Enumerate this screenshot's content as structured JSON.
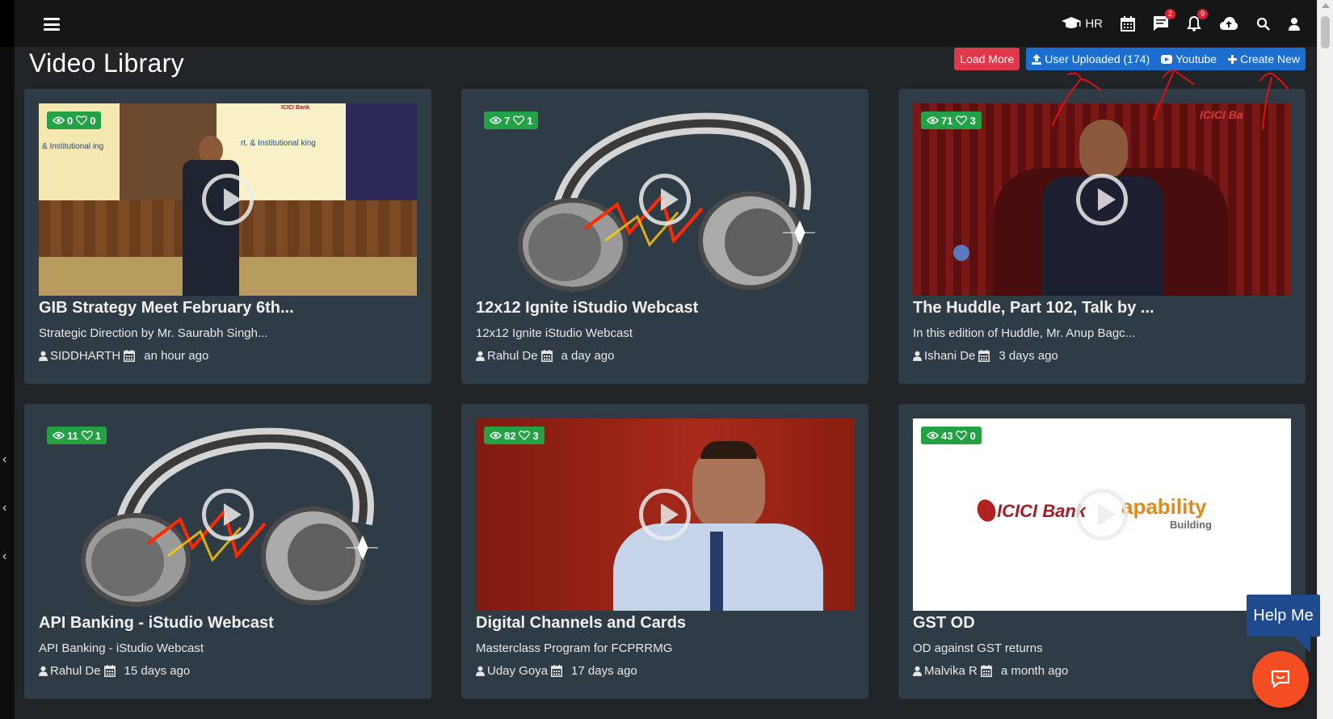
{
  "header": {
    "hr_label": "HR",
    "messages_badge": "2",
    "notifications_badge": "9"
  },
  "page": {
    "title": "Video Library"
  },
  "actions": {
    "load_more": "Load More",
    "user_uploaded": "User Uploaded (174)",
    "youtube": "Youtube",
    "create_new": "Create New"
  },
  "videos": [
    {
      "views": "0",
      "likes": "0",
      "title": "GIB Strategy Meet February 6th...",
      "description": "Strategic Direction by Mr. Saurabh Singh...",
      "author": "SIDDHARTH",
      "time": "an hour ago",
      "thumb": "presentation-stage"
    },
    {
      "views": "7",
      "likes": "1",
      "title": "12x12 Ignite iStudio Webcast",
      "description": "12x12 Ignite iStudio Webcast",
      "author": "Rahul De",
      "time": "a day ago",
      "thumb": "headphones"
    },
    {
      "views": "71",
      "likes": "3",
      "title": "The Huddle, Part 102, Talk by ...",
      "description": "In this edition of Huddle, Mr. Anup Bagc...",
      "author": "Ishani De",
      "time": "3 days ago",
      "thumb": "man-in-armchair"
    },
    {
      "views": "11",
      "likes": "1",
      "title": "API Banking - iStudio Webcast",
      "description": "API Banking - iStudio Webcast",
      "author": "Rahul De",
      "time": "15 days ago",
      "thumb": "headphones"
    },
    {
      "views": "82",
      "likes": "3",
      "title": "Digital Channels and Cards",
      "description": "Masterclass Program for FCPRRMG",
      "author": "Uday Goya",
      "time": "17 days ago",
      "thumb": "speaker-closeup"
    },
    {
      "views": "43",
      "likes": "0",
      "title": "GST OD",
      "description": "OD against GST returns",
      "author": "Malvika R",
      "time": "a month ago",
      "thumb": "capability-logo"
    }
  ],
  "thumb_text": {
    "v0_slide_left": "& Institutional ing",
    "v0_slide_right": "rt. & Institutional king",
    "v0_slide_logo": "ICICI Bank",
    "v2_logo": "ICICI Ba",
    "v5_logo_left": "ICICI Bank",
    "v5_logo_right": "apability",
    "v5_logo_sub": "Building"
  },
  "help": {
    "label": "Help Me"
  },
  "colors": {
    "background": "#222527",
    "card": "#2f3c46",
    "stats_badge": "#22a245",
    "load_more": "#e0374a",
    "button_group": "#1a6fd1",
    "help_box": "#1f4b8e",
    "chat_button": "#f44d22",
    "annotation": "#e01010"
  }
}
